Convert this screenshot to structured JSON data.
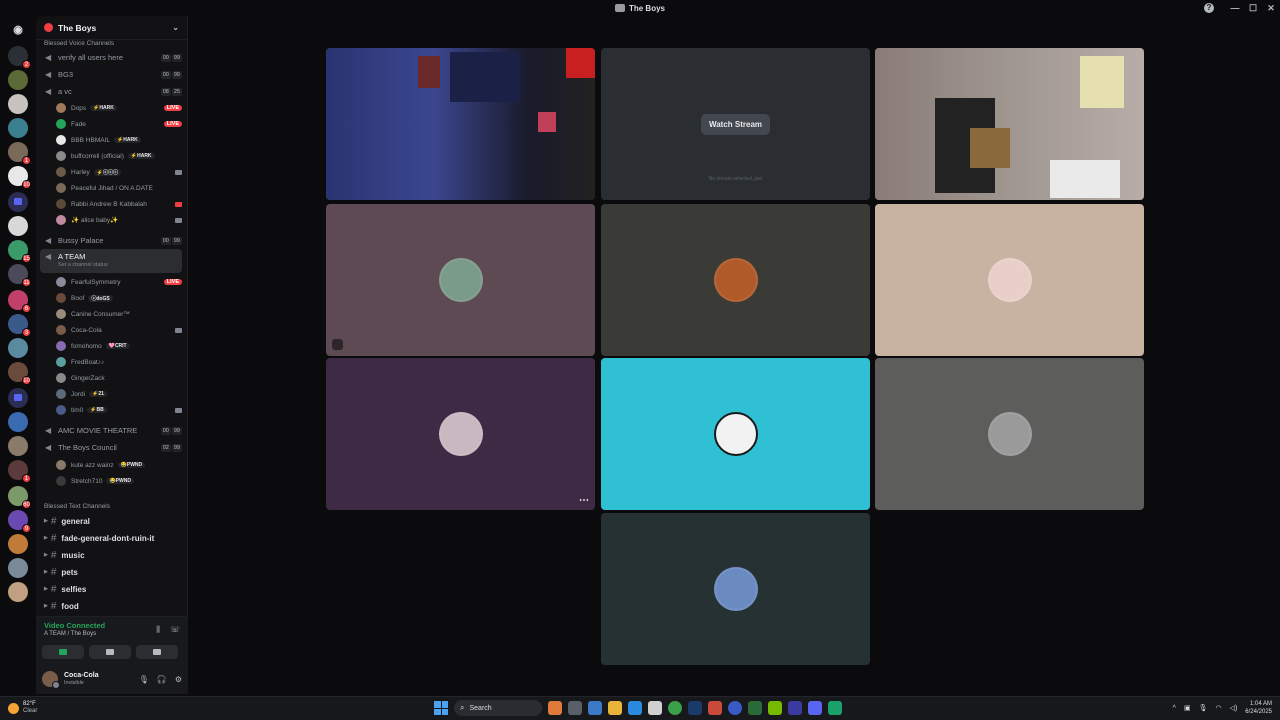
{
  "window": {
    "title": "The Boys",
    "controls": [
      "—",
      "☐",
      "✕"
    ],
    "help": "?"
  },
  "guild_badges": [
    "2",
    "1",
    "10",
    "15",
    "11",
    "6",
    "3",
    "10",
    "1",
    "60",
    "9"
  ],
  "sidebar": {
    "server_name": "The Boys",
    "voice_category": "Blessed Voice Channels",
    "text_category": "Blessed Text Channels",
    "voice_channels": [
      {
        "name": "verify all users here",
        "limit": [
          "00",
          "99"
        ]
      },
      {
        "name": "BG3",
        "limit": [
          "00",
          "99"
        ]
      },
      {
        "name": "a vc",
        "limit": [
          "08",
          "25"
        ]
      },
      {
        "name": "Bussy Palace",
        "limit": [
          "00",
          "99"
        ]
      },
      {
        "name": "A TEAM",
        "status": "Set a channel status"
      },
      {
        "name": "AMC MOVIE THEATRE",
        "limit": [
          "00",
          "99"
        ]
      },
      {
        "name": "The Boys Council",
        "limit": [
          "02",
          "99"
        ]
      }
    ],
    "avc_users": [
      {
        "name": "Dops",
        "tag": "⚡HARK",
        "live": "LIVE"
      },
      {
        "name": "Fade",
        "live": "LIVE"
      },
      {
        "name": "BBB HBMAIL",
        "tag": "⚡HARK"
      },
      {
        "name": "buffcorrell (official)",
        "tag": "⚡HARK"
      },
      {
        "name": "Harley",
        "tag": "⚡ⓒⓒⓒ"
      },
      {
        "name": "Peaceful Jihad / ON A DATE"
      },
      {
        "name": "Rabbi Andrew B Kabbalah"
      },
      {
        "name": "✨ alice baby✨"
      }
    ],
    "ateam_users": [
      {
        "name": "FearfulSymmetry",
        "live": "LIVE"
      },
      {
        "name": "Boof",
        "tag": "ⓒdoGS"
      },
      {
        "name": "Canine Consumer™"
      },
      {
        "name": "Coca-Cola"
      },
      {
        "name": "fomohomo",
        "tag": "🩷CRIT"
      },
      {
        "name": "FredBoat♪♪"
      },
      {
        "name": "GingerZack"
      },
      {
        "name": "Jordi",
        "tag": "⚡21"
      },
      {
        "name": "tim0",
        "tag": "⚡BB"
      }
    ],
    "council_users": [
      {
        "name": "kute azz wainz",
        "tag": "😂PWND"
      },
      {
        "name": "Stretch710",
        "tag": "😂PWND"
      }
    ],
    "text_channels": [
      "general",
      "fade-general-dont-ruin-it",
      "music",
      "pets",
      "selfies",
      "food"
    ]
  },
  "voice_panel": {
    "status": "Video Connected",
    "location": "A TEAM / The Boys"
  },
  "user_panel": {
    "name": "Coca-Cola",
    "status": "Invisible"
  },
  "stage": {
    "watch_label": "Watch Stream",
    "stream_caption": "No stream selected, just"
  },
  "tile_colors": [
    "#5d4a52",
    "#3a3a36",
    "#c8b2a2",
    "#3f2a45",
    "#2fc0d4",
    "#5d5d5b",
    "#263133"
  ],
  "taskbar": {
    "temp": "82°F",
    "weather": "Clear",
    "search": "Search",
    "time": "1:04 AM",
    "date": "6/24/2025"
  }
}
